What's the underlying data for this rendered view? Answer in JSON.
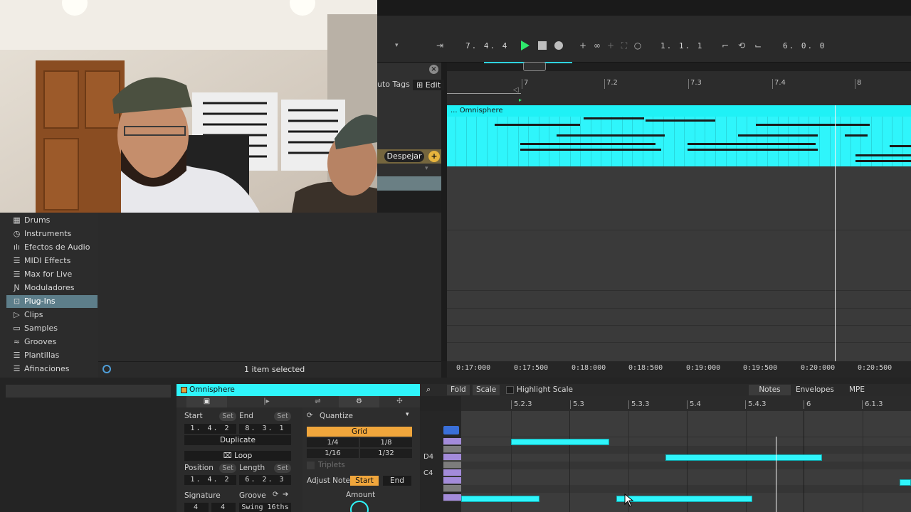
{
  "transport": {
    "position_left": "7. 4. 4",
    "position_right": "1. 1. 1",
    "loop_length": "6. 0. 0"
  },
  "browser": {
    "tags_label": "uto Tags",
    "edit_label": "Edit",
    "clear_label": "Despejar",
    "add_label": "+",
    "categories": [
      {
        "label": "Drums",
        "icon": "drums-icon"
      },
      {
        "label": "Instruments",
        "icon": "instrument-icon"
      },
      {
        "label": "Efectos de Audio",
        "icon": "audio-effects-icon"
      },
      {
        "label": "MIDI Effects",
        "icon": "midi-effects-icon"
      },
      {
        "label": "Max for Live",
        "icon": "max-for-live-icon"
      },
      {
        "label": "Moduladores",
        "icon": "modulators-icon"
      },
      {
        "label": "Plug-Ins",
        "icon": "plugins-icon",
        "selected": true
      },
      {
        "label": "Clips",
        "icon": "clips-icon"
      },
      {
        "label": "Samples",
        "icon": "samples-icon"
      },
      {
        "label": "Grooves",
        "icon": "grooves-icon"
      },
      {
        "label": "Plantillas",
        "icon": "templates-icon"
      },
      {
        "label": "Afinaciones",
        "icon": "tunings-icon"
      }
    ],
    "status": "1 item selected"
  },
  "arrangement": {
    "ruler": [
      "7",
      "7.2",
      "7.3",
      "7.4",
      "8"
    ],
    "clip_name": "... Omnisphere",
    "time_labels": [
      "0:17:000",
      "0:17:500",
      "0:18:000",
      "0:18:500",
      "0:19:000",
      "0:19:500",
      "0:20:000",
      "0:20:500"
    ]
  },
  "clip_view": {
    "title": "Omnisphere",
    "start_label": "Start",
    "end_label": "End",
    "set_label": "Set",
    "start_value": "1. 4. 2",
    "end_value": "8. 3. 1",
    "duplicate_label": "Duplicate",
    "loop_label": "Loop",
    "position_label": "Position",
    "length_label": "Length",
    "position_value": "1. 4. 2",
    "length_value": "6. 2. 3",
    "signature_label": "Signature",
    "groove_label": "Groove",
    "sig_num": "4",
    "sig_den": "4",
    "groove_value": "Swing 16ths"
  },
  "quantize": {
    "label": "Quantize",
    "grid_label": "Grid",
    "values": [
      "1/4",
      "1/8",
      "1/16",
      "1/32"
    ],
    "triplets_label": "Triplets",
    "adjust_label": "Adjust Note",
    "start_label": "Start",
    "end_label": "End",
    "amount_label": "Amount"
  },
  "piano_roll": {
    "fold_label": "Fold",
    "scale_label": "Scale",
    "highlight_label": "Highlight Scale",
    "tabs": [
      "Notes",
      "Envelopes",
      "MPE"
    ],
    "ruler": [
      "5.2.3",
      "5.3",
      "5.3.3",
      "5.4",
      "5.4.3",
      "6",
      "6.1.3"
    ],
    "key_labels": [
      "D4",
      "C4"
    ]
  },
  "colors": {
    "clip": "#2ff5fb",
    "play": "#2ee86b",
    "grid_highlight": "#f0a63c",
    "selected_browser": "#5d7e8a"
  }
}
